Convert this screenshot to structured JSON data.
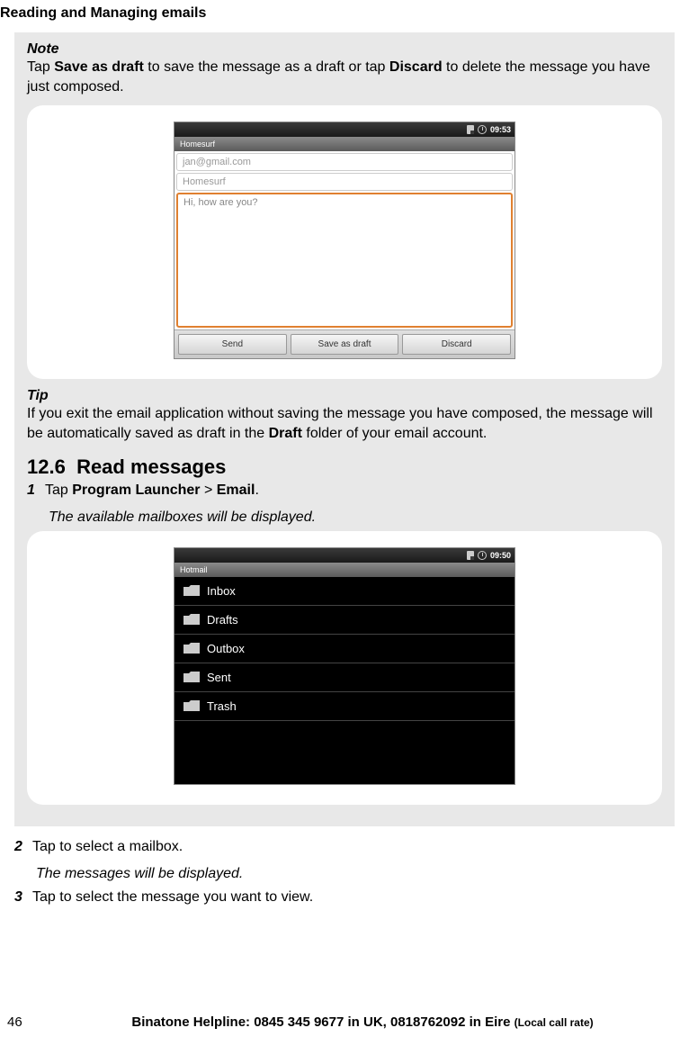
{
  "header": {
    "title": "Reading and Managing emails"
  },
  "note": {
    "heading": "Note",
    "text_pre": "Tap ",
    "bold1": "Save as draft",
    "text_mid": " to save the message as a draft or tap ",
    "bold2": "Discard",
    "text_post": " to delete the message you have just composed."
  },
  "compose_screenshot": {
    "time": "09:53",
    "title": "Homesurf",
    "to_field": "jan@gmail.com",
    "subject_field": "Homesurf",
    "body_field": "Hi, how are you?",
    "buttons": {
      "send": "Send",
      "save": "Save as draft",
      "discard": "Discard"
    }
  },
  "tip": {
    "heading": "Tip",
    "text_pre": "If you exit the email application without saving the message you have composed, the message will be automatically saved as draft in the ",
    "bold1": "Draft",
    "text_post": " folder of your email account."
  },
  "section": {
    "number": "12.6",
    "title": "Read messages"
  },
  "step1": {
    "num": "1",
    "pre": "Tap ",
    "b1": "Program Launcher",
    "mid": " > ",
    "b2": "Email",
    "post": ".",
    "result": "The available mailboxes will be displayed."
  },
  "mailbox_screenshot": {
    "time": "09:50",
    "title": "Hotmail",
    "items": [
      "Inbox",
      "Drafts",
      "Outbox",
      "Sent",
      "Trash"
    ]
  },
  "step2": {
    "num": "2",
    "text": "Tap to select a mailbox.",
    "result": "The messages will be displayed."
  },
  "step3": {
    "num": "3",
    "text": "Tap to select the message you want to view."
  },
  "footer": {
    "page": "46",
    "helpline_main": "Binatone Helpline: 0845 345 9677 in UK, 0818762092 in Eire ",
    "helpline_small": "(Local call rate)"
  }
}
